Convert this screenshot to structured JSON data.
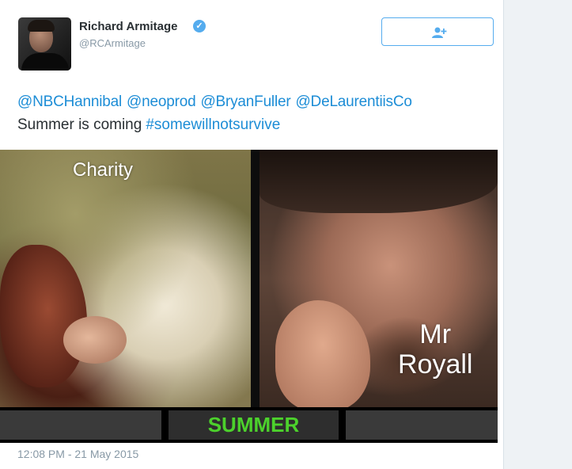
{
  "tweet": {
    "author_name": "Richard Armitage",
    "handle": "@RCArmitage",
    "mentions": [
      "@NBCHannibal",
      "@neoprod",
      "@BryanFuller",
      "@DeLaurentiisCo"
    ],
    "text": "Summer is coming",
    "hashtag": "#somewillnotsurvive",
    "timestamp": "12:08 PM - 21 May 2015"
  },
  "media": {
    "left_label": "Charity",
    "right_label_line1": "Mr",
    "right_label_line2": "Royall",
    "bottom_label": "SUMMER"
  },
  "colors": {
    "link": "#1d8dd6",
    "verified": "#55acee",
    "summer_text": "#4cd12c",
    "text": "#292f33",
    "muted": "#8899a6"
  },
  "icons": {
    "verified": "verified-badge-icon",
    "follow": "add-user-icon"
  }
}
